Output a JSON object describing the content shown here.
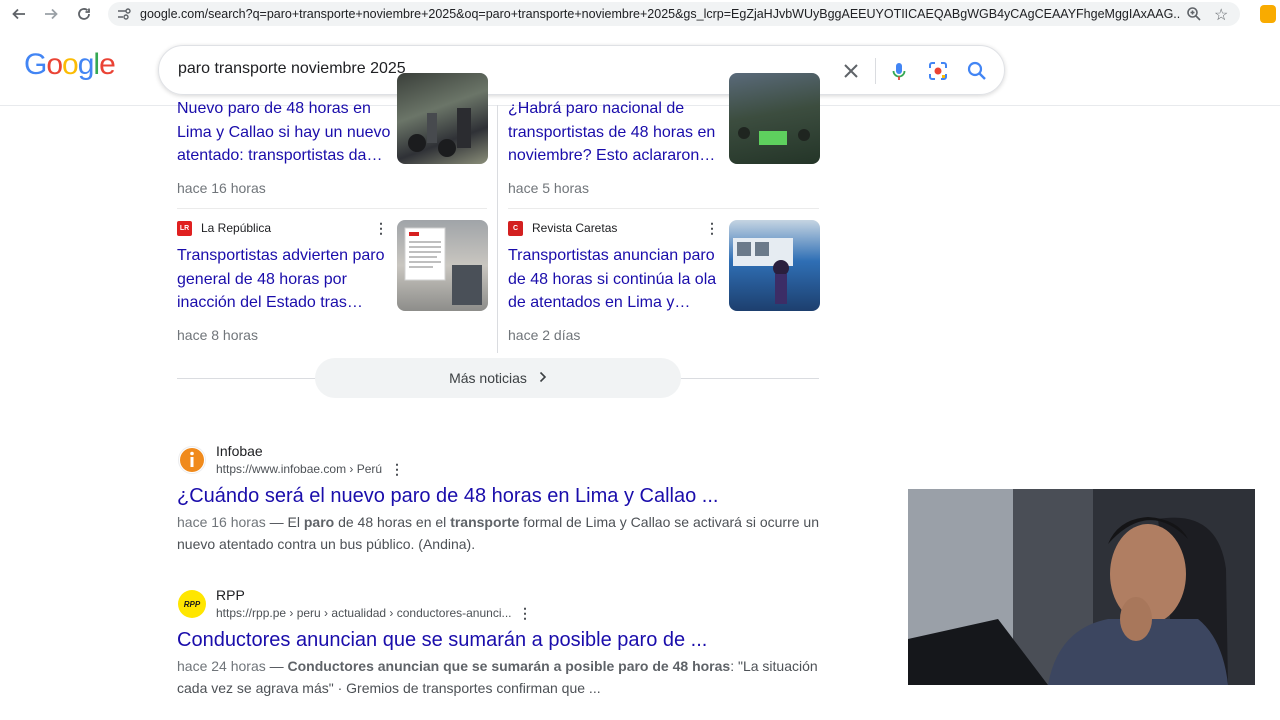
{
  "browser": {
    "url": "google.com/search?q=paro+transporte+noviembre+2025&oq=paro+transporte+noviembre+2025&gs_lcrp=EgZjaHJvbWUyBggAEEUYOTIICAEQABgWGB4yCAgCEAAYFhgeMggIAxAAG..."
  },
  "header": {
    "logo": [
      "G",
      "o",
      "o",
      "g",
      "l",
      "e"
    ],
    "logo_colors": [
      "#4285f4",
      "#ea4335",
      "#fbbc05",
      "#4285f4",
      "#34a853",
      "#ea4335"
    ],
    "search_value": "paro transporte noviembre 2025"
  },
  "news": {
    "top_left": {
      "title_lines": [
        "Nuevo paro de 48 horas en",
        "Lima y Callao si hay un nuevo",
        "atentado: transportistas da…"
      ],
      "time": "hace 16 horas"
    },
    "top_right": {
      "title_lines": [
        "¿Habrá paro nacional de",
        "transportistas de 48 horas en",
        "noviembre? Esto aclararon…"
      ],
      "time": "hace 5 horas"
    },
    "bottom_left": {
      "source": "La República",
      "source_logo": "LR",
      "source_color": "#e02020",
      "title_lines": [
        "Transportistas advierten paro",
        "general de 48 horas por",
        "inacción del Estado tras…"
      ],
      "time": "hace 8 horas"
    },
    "bottom_right": {
      "source": "Revista Caretas",
      "source_logo": "C",
      "source_color": "#d32020",
      "title_lines": [
        "Transportistas anuncian paro",
        "de 48 horas si continúa la ola",
        "de atentados en Lima y…"
      ],
      "time": "hace 2 días"
    },
    "more_label": "Más noticias"
  },
  "results": [
    {
      "site": "Infobae",
      "url": "https://www.infobae.com › Perú",
      "favicon_color": "#f08a1c",
      "title": "¿Cuándo será el nuevo paro de 48 horas en Lima y Callao ...",
      "snippet_date": "hace 16 horas",
      "snippet_parts": [
        " — El ",
        "paro",
        " de 48 horas en el ",
        "transporte",
        " formal de Lima y Callao se activará si ocurre un"
      ],
      "snippet_line2": "nuevo atentado contra un bus público. (Andina)."
    },
    {
      "site": "RPP",
      "url": "https://rpp.pe › peru › actualidad › conductores-anunci...",
      "favicon_color": "#ffe600",
      "favicon_text": "RPP",
      "title": "Conductores anuncian que se sumarán a posible paro de ...",
      "snippet_date": "hace 24 horas",
      "snippet_bold": "Conductores anuncian que se sumarán a posible paro de 48 horas",
      "snippet_rest": ": \"La situación",
      "snippet_line2": "cada vez se agrava más\" · Gremios de transportes confirman que ..."
    }
  ]
}
